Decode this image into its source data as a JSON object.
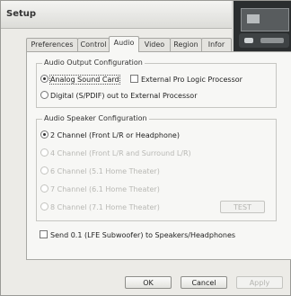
{
  "window": {
    "title": "Setup"
  },
  "tabs": [
    {
      "label": "Preferences",
      "active": false
    },
    {
      "label": "Control",
      "active": false
    },
    {
      "label": "Audio",
      "active": true
    },
    {
      "label": "Video",
      "active": false
    },
    {
      "label": "Region",
      "active": false
    },
    {
      "label": "Infor",
      "active": false
    }
  ],
  "output": {
    "legend": "Audio Output Configuration",
    "analog_label": "Analog Sound Card",
    "external_label": "External Pro Logic Processor",
    "digital_label": "Digital (S/PDIF) out to External Processor"
  },
  "speaker": {
    "legend": "Audio Speaker Configuration",
    "options": [
      "2 Channel (Front L/R or Headphone)",
      "4 Channel (Front L/R and Surround L/R)",
      "6 Channel (5.1 Home Theater)",
      "7 Channel (6.1 Home Theater)",
      "8 Channel (7.1 Home Theater)"
    ],
    "test_label": "TEST"
  },
  "send_label": "Send 0.1 (LFE Subwoofer) to Speakers/Headphones",
  "buttons": {
    "ok": "OK",
    "cancel": "Cancel",
    "apply": "Apply"
  }
}
